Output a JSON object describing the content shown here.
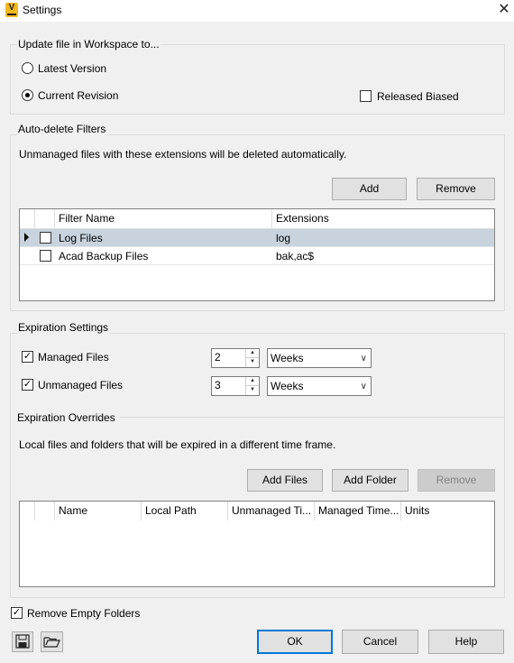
{
  "window": {
    "title": "Settings",
    "app_icon_letter": "V"
  },
  "update_file": {
    "group_label": "Update file in Workspace to...",
    "latest_version_label": "Latest Version",
    "current_revision_label": "Current Revision",
    "selected": "Current Revision",
    "released_biased_label": "Released Biased",
    "released_biased_checked": false
  },
  "auto_delete": {
    "group_label": "Auto-delete Filters",
    "description": "Unmanaged files with these extensions will be deleted automatically.",
    "add_label": "Add",
    "remove_label": "Remove",
    "columns": [
      "Filter Name",
      "Extensions"
    ],
    "rows": [
      {
        "name": "Log Files",
        "extensions": "log",
        "checked": false,
        "selected": true
      },
      {
        "name": "Acad Backup Files",
        "extensions": "bak,ac$",
        "checked": false,
        "selected": false
      }
    ]
  },
  "expiration": {
    "group_label": "Expiration Settings",
    "managed_label": "Managed Files",
    "managed_checked": true,
    "managed_value": "2",
    "managed_unit": "Weeks",
    "unmanaged_label": "Unmanaged Files",
    "unmanaged_checked": true,
    "unmanaged_value": "3",
    "unmanaged_unit": "Weeks"
  },
  "overrides": {
    "group_label": "Expiration Overrides",
    "description": "Local files and folders that will be expired in a different time frame.",
    "add_files_label": "Add Files",
    "add_folder_label": "Add Folder",
    "remove_label": "Remove",
    "columns": [
      "Name",
      "Local Path",
      "Unmanaged Ti...",
      "Managed Time...",
      "Units"
    ]
  },
  "remove_empty_folders": {
    "label": "Remove Empty Folders",
    "checked": true
  },
  "footer": {
    "ok_label": "OK",
    "cancel_label": "Cancel",
    "help_label": "Help",
    "icons": [
      "save-icon",
      "folder-open-icon"
    ]
  },
  "colors": {
    "accent": "#0078d7",
    "selected_row": "#c8d3de",
    "app_icon": "#f3b81b"
  }
}
